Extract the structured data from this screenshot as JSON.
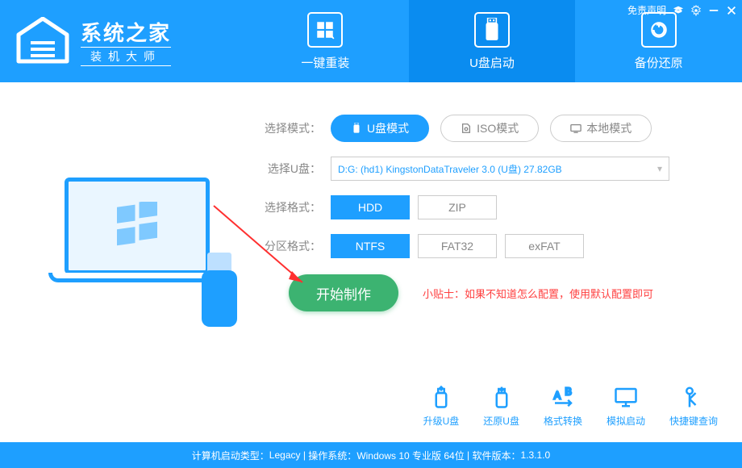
{
  "titlebar": {
    "disclaimer": "免责声明"
  },
  "logo": {
    "title": "系统之家",
    "subtitle": "装机大师"
  },
  "tabs": [
    {
      "label": "一键重装"
    },
    {
      "label": "U盘启动"
    },
    {
      "label": "备份还原"
    }
  ],
  "mode": {
    "label": "选择模式：",
    "options": {
      "usb": "U盘模式",
      "iso": "ISO模式",
      "local": "本地模式"
    }
  },
  "udisk": {
    "label": "选择U盘：",
    "value": "D:G: (hd1) KingstonDataTraveler 3.0 (U盘) 27.82GB"
  },
  "format": {
    "label": "选择格式：",
    "options": {
      "hdd": "HDD",
      "zip": "ZIP"
    }
  },
  "partition": {
    "label": "分区格式：",
    "options": {
      "ntfs": "NTFS",
      "fat32": "FAT32",
      "exfat": "exFAT"
    }
  },
  "start": {
    "button": "开始制作",
    "tip": "小贴士：如果不知道怎么配置，使用默认配置即可"
  },
  "tools": {
    "upgrade": "升级U盘",
    "restore": "还原U盘",
    "convert": "格式转换",
    "simulate": "模拟启动",
    "hotkey": "快捷键查询"
  },
  "status": {
    "boot_label": "计算机启动类型：",
    "boot_value": "Legacy",
    "os_label": "操作系统：",
    "os_value": "Windows 10 专业版 64位",
    "ver_label": "软件版本：",
    "ver_value": "1.3.1.0"
  }
}
